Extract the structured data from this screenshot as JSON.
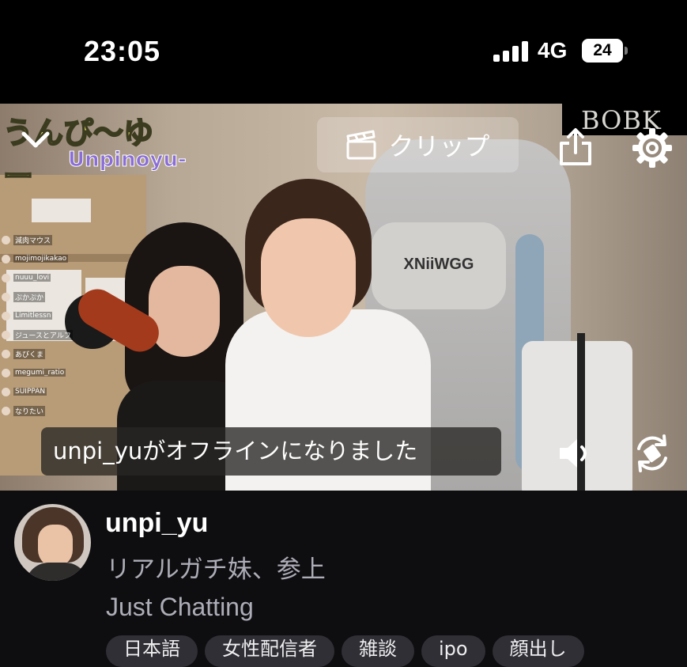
{
  "status_bar": {
    "time": "23:05",
    "network": "4G",
    "battery": "24"
  },
  "video": {
    "overlay_logo_jp": "うんぴ〜ゆー",
    "overlay_logo_en": "Unpinoyu-",
    "watermark": "BOBK",
    "chair_brand": "XNiiWGG",
    "clip_label": "クリップ",
    "offline_message": "unpi_yuがオフラインになりました",
    "chat_overlay": [
      "減肉マウス",
      "mojimojikakao",
      "nuuu_lovi",
      "ぷかぷか",
      "Limitlessn",
      "ジュースとアルフ",
      "あびくま",
      "megumi_ratio",
      "SUIPPAN",
      "なりたい"
    ]
  },
  "channel": {
    "username": "unpi_yu",
    "title": "リアルガチ妹、参上",
    "category": "Just Chatting",
    "tags": [
      "日本語",
      "女性配信者",
      "雑談",
      "ipo",
      "顔出し"
    ]
  },
  "colors": {
    "background": "#0e0e10",
    "status_bar": "#000000",
    "secondary_text": "#adadb8",
    "tag_bg": "#2f2f35"
  },
  "icons": {
    "collapse": "chevron-down-icon",
    "clip": "clapperboard-icon",
    "share": "share-icon",
    "settings": "gear-icon",
    "volume": "volume-icon",
    "rotate": "rotate-screen-icon"
  }
}
